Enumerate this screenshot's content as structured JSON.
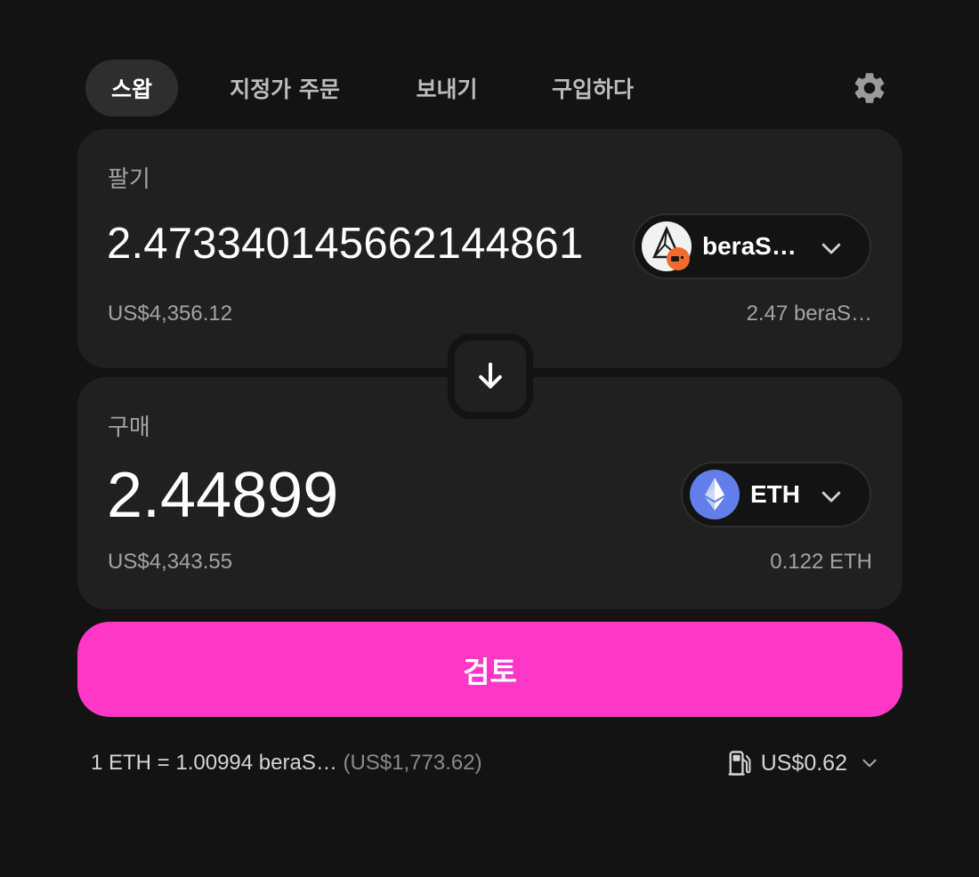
{
  "tabs": [
    {
      "label": "스왑",
      "active": true
    },
    {
      "label": "지정가 주문",
      "active": false
    },
    {
      "label": "보내기",
      "active": false
    },
    {
      "label": "구입하다",
      "active": false
    }
  ],
  "settings_icon": "gear-icon",
  "sell": {
    "label": "팔기",
    "amount": "2.47334014566214486",
    "amount_visible": "2.473340145662144861",
    "usd_value": "US$4,356.12",
    "balance": "2.47 beraS…",
    "token": {
      "symbol": "beraS…",
      "icon": "berastone-token-icon"
    }
  },
  "swap_direction_icon": "arrow-down-icon",
  "buy": {
    "label": "구매",
    "amount": "2.44899",
    "usd_value": "US$4,343.55",
    "balance": "0.122 ETH",
    "token": {
      "symbol": "ETH",
      "icon": "ethereum-token-icon",
      "color": "#627eea"
    }
  },
  "review_button": {
    "label": "검토",
    "color": "#ff37c7"
  },
  "footer": {
    "rate": "1 ETH = 1.00994 beraS…",
    "rate_usd": "(US$1,773.62)",
    "gas_icon": "gas-pump-icon",
    "gas_fee": "US$0.62"
  },
  "colors": {
    "background": "#131313",
    "card": "#202020",
    "accent": "#ff37c7",
    "muted_text": "#a3a3a3"
  }
}
